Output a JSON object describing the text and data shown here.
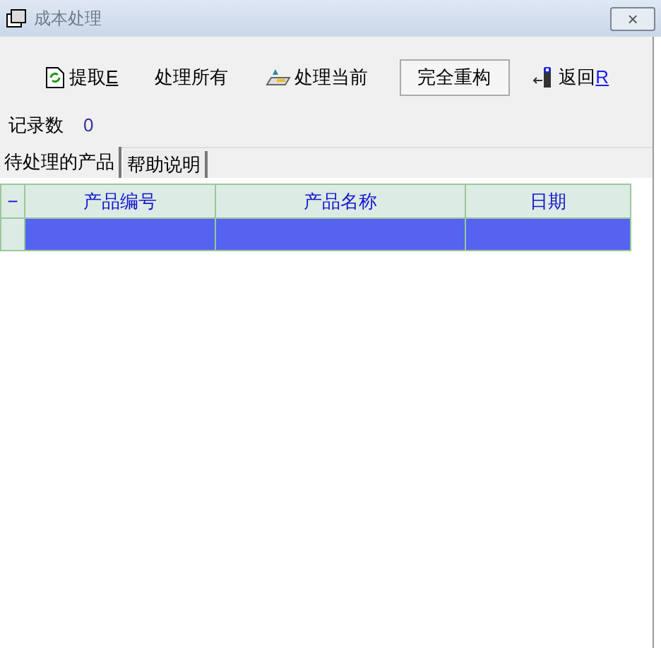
{
  "window": {
    "title": "成本处理",
    "close": "×"
  },
  "toolbar": [
    {
      "kind": "icon",
      "label": "提取",
      "hotkey": "E",
      "selected": false
    },
    {
      "kind": "plain",
      "label": "处理所有",
      "selected": false
    },
    {
      "kind": "icon",
      "label": "处理当前",
      "selected": false
    },
    {
      "kind": "plain",
      "label": "完全重构",
      "selected": true
    },
    {
      "kind": "icon",
      "label": "返回",
      "hotkey": "R",
      "selected": false
    }
  ],
  "record_count": {
    "label": "记录数",
    "value": "0"
  },
  "tabs": [
    {
      "label": "待处理的产品",
      "selected": true
    },
    {
      "label": "帮助说明",
      "selected": false
    }
  ],
  "grid": {
    "corner": "−",
    "columns": [
      "产品编号",
      "产品名称",
      "日期"
    ],
    "rows": [
      {
        "selected": true
      }
    ]
  }
}
